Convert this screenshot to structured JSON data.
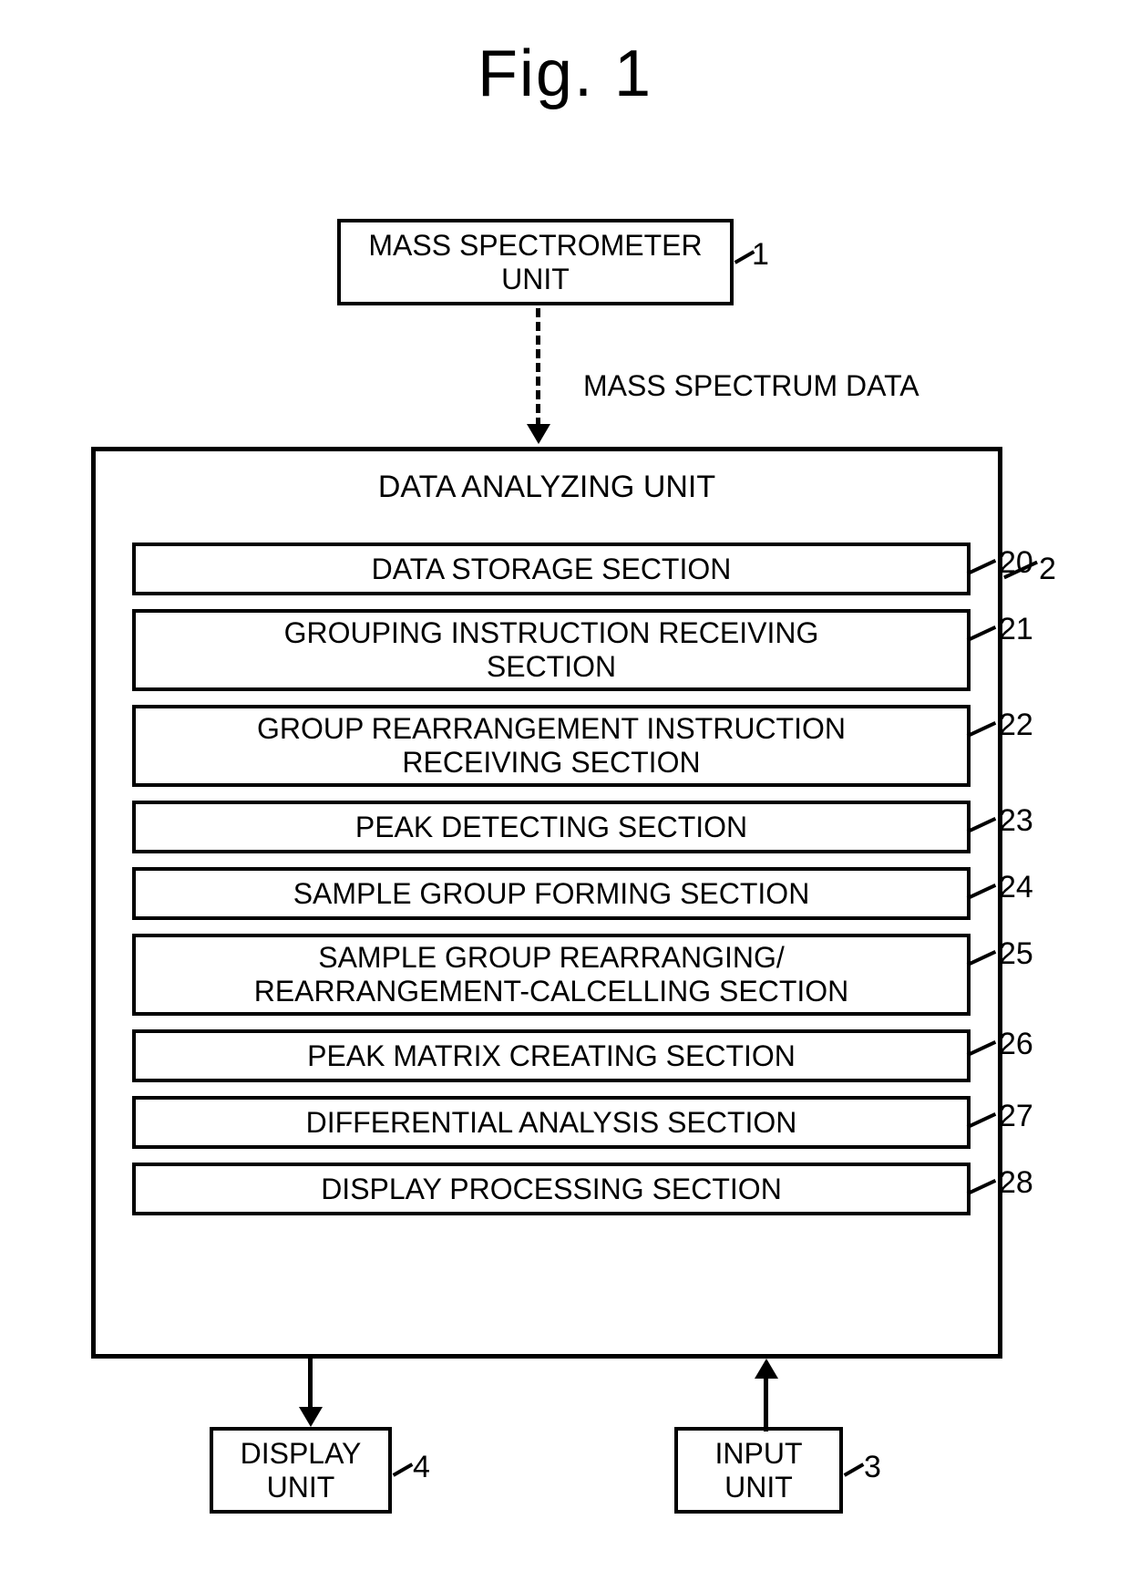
{
  "figure_title": "Fig. 1",
  "blocks": {
    "mass_spectrometer": {
      "label": "MASS SPECTROMETER\nUNIT",
      "ref": "1"
    },
    "flow_label": "MASS SPECTRUM DATA",
    "data_analyzing_unit": {
      "title": "DATA ANALYZING UNIT",
      "ref": "2"
    },
    "display_unit": {
      "label": "DISPLAY\nUNIT",
      "ref": "4"
    },
    "input_unit": {
      "label": "INPUT\nUNIT",
      "ref": "3"
    }
  },
  "sections": [
    {
      "label": "DATA STORAGE SECTION",
      "ref": "20"
    },
    {
      "label": "GROUPING INSTRUCTION RECEIVING\nSECTION",
      "ref": "21"
    },
    {
      "label": "GROUP REARRANGEMENT INSTRUCTION\nRECEIVING SECTION",
      "ref": "22"
    },
    {
      "label": "PEAK DETECTING SECTION",
      "ref": "23"
    },
    {
      "label": "SAMPLE GROUP FORMING SECTION",
      "ref": "24"
    },
    {
      "label": "SAMPLE GROUP REARRANGING/\nREARRANGEMENT-CALCELLING SECTION",
      "ref": "25"
    },
    {
      "label": "PEAK MATRIX CREATING SECTION",
      "ref": "26"
    },
    {
      "label": "DIFFERENTIAL ANALYSIS SECTION",
      "ref": "27"
    },
    {
      "label": "DISPLAY PROCESSING SECTION",
      "ref": "28"
    }
  ]
}
